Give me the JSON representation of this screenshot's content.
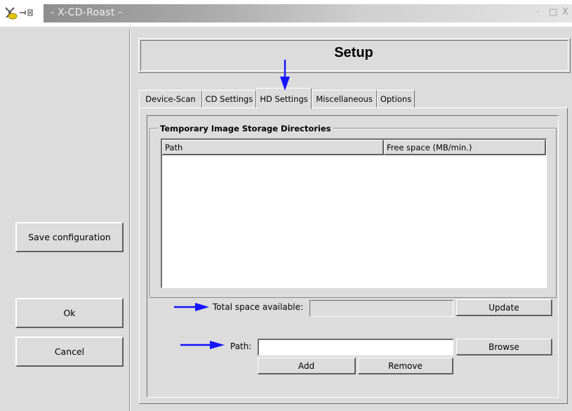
{
  "window": {
    "title": "- X-CD-Roast -",
    "controls": [
      "·",
      "□",
      "X"
    ]
  },
  "left_panel": {
    "save_label": "Save configuration",
    "ok_label": "Ok",
    "cancel_label": "Cancel"
  },
  "header": {
    "title": "Setup"
  },
  "tabs": [
    {
      "label": "Device-Scan",
      "active": false
    },
    {
      "label": "CD Settings",
      "active": false
    },
    {
      "label": "HD Settings",
      "active": true
    },
    {
      "label": "Miscellaneous",
      "active": false
    },
    {
      "label": "Options",
      "active": false
    }
  ],
  "storage": {
    "group_label": "Temporary Image Storage Directories",
    "columns": [
      "Path",
      "Free space (MB/min.)"
    ],
    "rows": []
  },
  "space": {
    "label": "Total space available:",
    "value": "",
    "update_label": "Update"
  },
  "path": {
    "label": "Path:",
    "value": "",
    "browse_label": "Browse",
    "add_label": "Add",
    "remove_label": "Remove"
  },
  "colors": {
    "annotation_arrow": "#1515ff"
  }
}
